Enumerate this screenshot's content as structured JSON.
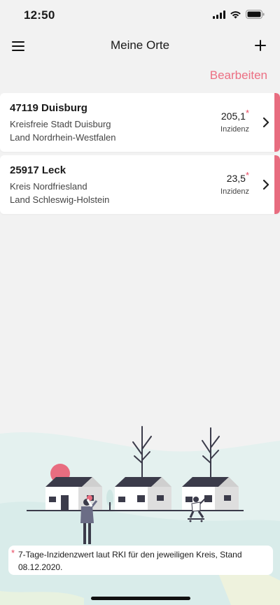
{
  "status": {
    "time": "12:50"
  },
  "nav": {
    "title": "Meine Orte"
  },
  "edit_label": "Bearbeiten",
  "places": [
    {
      "title": "47119 Duisburg",
      "district": "Kreisfreie Stadt Duisburg",
      "state": "Land Nordrhein-Westfalen",
      "value": "205,1",
      "star": "*",
      "unit": "Inzidenz"
    },
    {
      "title": "25917 Leck",
      "district": "Kreis Nordfriesland",
      "state": "Land Schleswig-Holstein",
      "value": "23,5",
      "star": "*",
      "unit": "Inzidenz"
    }
  ],
  "footnote": {
    "star": "*",
    "text": "7-Tage-Inzidenzwert laut RKI für den jeweiligen Kreis, Stand 08.12.2020."
  },
  "colors": {
    "accent": "#e86d80",
    "link": "#ec6f83",
    "star": "#e8475f",
    "background": "#f2f2f2"
  },
  "icons": {
    "menu": "hamburger-menu-icon",
    "add": "plus-icon",
    "chevron": "chevron-right-icon",
    "signal": "cellular-signal-icon",
    "wifi": "wifi-icon",
    "battery": "battery-icon"
  }
}
